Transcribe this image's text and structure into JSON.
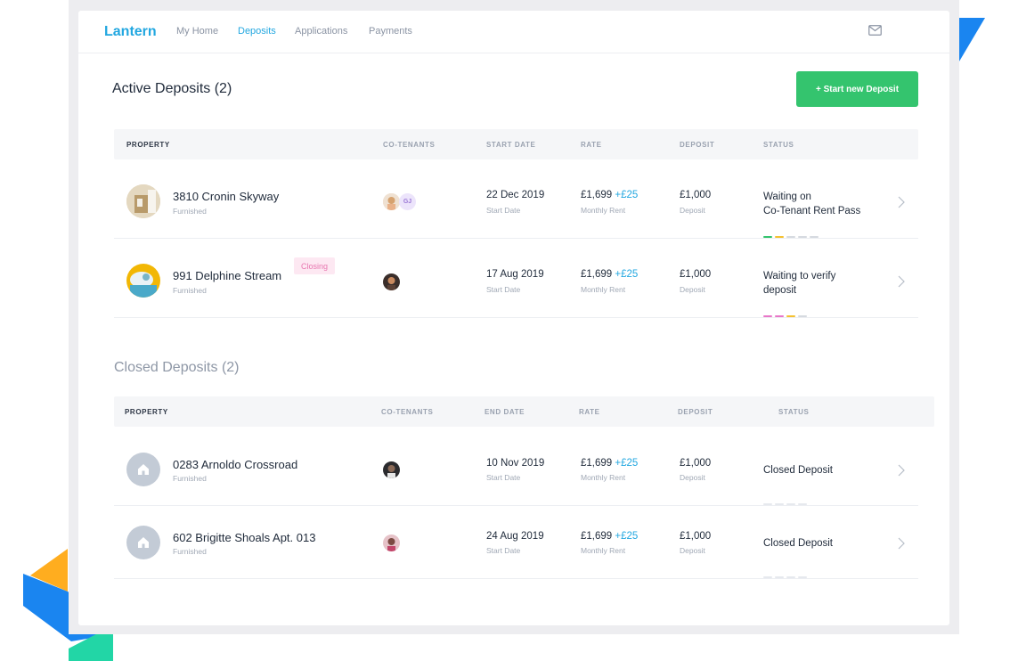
{
  "nav": {
    "brand": "Lantern",
    "links": [
      "My Home",
      "Deposits",
      "Applications",
      "Payments"
    ],
    "active_link": "Deposits"
  },
  "active": {
    "title": "Active Deposits (2)",
    "new_button": "+ Start new Deposit",
    "headers": [
      "PROPERTY",
      "CO-TENANTS",
      "START DATE",
      "RATE",
      "DEPOSIT",
      "STATUS"
    ],
    "rows": [
      {
        "name": "3810 Cronin Skyway",
        "furnishing": "Furnished",
        "co_tenants": [
          "photo",
          "GJ"
        ],
        "date": "22 Dec 2019",
        "date_label": "Start Date",
        "rate": "£1,699",
        "rate_delta": "+£25",
        "rate_label": "Monthly Rent",
        "deposit": "£1,000",
        "deposit_label": "Deposit",
        "status_line1": "Waiting on",
        "status_line2": "Co-Tenant Rent Pass",
        "progress": [
          "#34c46e",
          "#f5c130",
          "#d6dae0",
          "#d6dae0",
          "#d6dae0"
        ]
      },
      {
        "name": "991 Delphine Stream",
        "tag": "Closing",
        "furnishing": "Furnished",
        "co_tenants": [
          "photo"
        ],
        "date": "17 Aug 2019",
        "date_label": "Start Date",
        "rate": "£1,699",
        "rate_delta": "+£25",
        "rate_label": "Monthly Rent",
        "deposit": "£1,000",
        "deposit_label": "Deposit",
        "status_line1": "Waiting to verify",
        "status_line2": "deposit",
        "progress": [
          "#e877c8",
          "#e877c8",
          "#f5c130",
          "#d6dae0"
        ]
      }
    ]
  },
  "closed": {
    "title": "Closed Deposits (2)",
    "headers": [
      "PROPERTY",
      "CO-TENANTS",
      "END DATE",
      "RATE",
      "DEPOSIT",
      "STATUS"
    ],
    "rows": [
      {
        "name": "0283 Arnoldo Crossroad",
        "furnishing": "Furnished",
        "date": "10 Nov 2019",
        "date_label": "Start Date",
        "rate": "£1,699",
        "rate_delta": "+£25",
        "rate_label": "Monthly Rent",
        "deposit": "£1,000",
        "deposit_label": "Deposit",
        "status": "Closed Deposit"
      },
      {
        "name": "602 Brigitte Shoals Apt. 013",
        "furnishing": "Furnished",
        "date": "24 Aug 2019",
        "date_label": "Start Date",
        "rate": "£1,699",
        "rate_delta": "+£25",
        "rate_label": "Monthly Rent",
        "deposit": "£1,000",
        "deposit_label": "Deposit",
        "status": "Closed Deposit"
      }
    ]
  },
  "colors": {
    "accent": "#22a7e0",
    "primary_button": "#34c46e",
    "closing_tag_text": "#e877b0",
    "closing_tag_bg": "#fde8f2"
  }
}
